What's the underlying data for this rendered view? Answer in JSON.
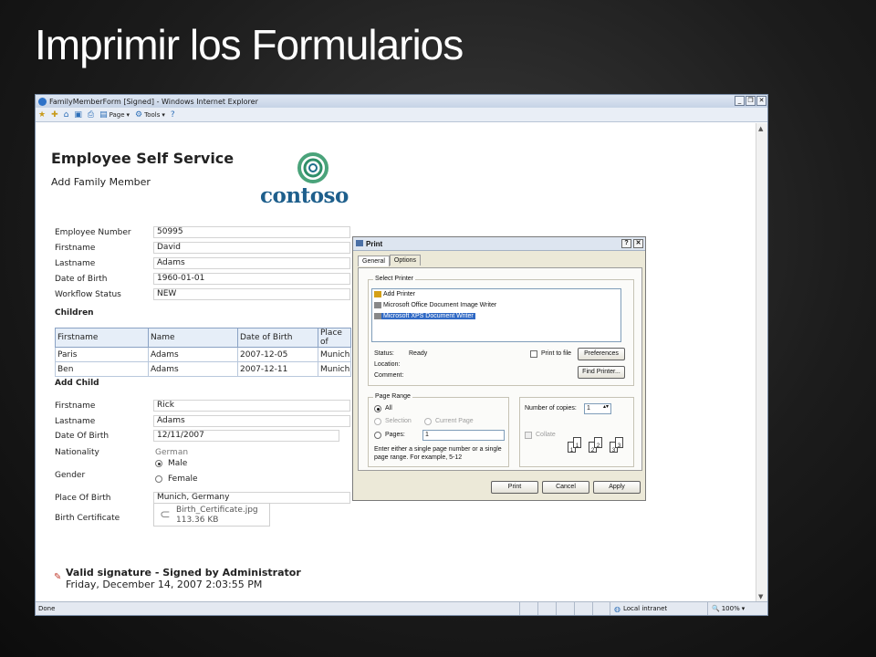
{
  "slide": {
    "title": "Imprimir los Formularios"
  },
  "browser": {
    "title": "FamilyMemberForm [Signed] - Windows Internet Explorer",
    "toolbar": {
      "page": "Page",
      "tools": "Tools"
    },
    "status": {
      "text": "Done",
      "zone": "Local intranet",
      "zoom": "100%"
    }
  },
  "page": {
    "app_title": "Employee Self Service",
    "subtitle": "Add Family Member",
    "logo_text": "contoso",
    "employee": {
      "number_label": "Employee Number",
      "number": "50995",
      "firstname_label": "Firstname",
      "firstname": "David",
      "lastname_label": "Lastname",
      "lastname": "Adams",
      "dob_label": "Date of Birth",
      "dob": "1960-01-01",
      "workflow_label": "Workflow Status",
      "workflow": "NEW"
    },
    "children": {
      "heading": "Children",
      "columns": [
        "Firstname",
        "Name",
        "Date of Birth",
        "Place of"
      ],
      "rows": [
        [
          "Paris",
          "Adams",
          "2007-12-05",
          "Munich"
        ],
        [
          "Ben",
          "Adams",
          "2007-12-11",
          "Munich"
        ]
      ]
    },
    "add_child": {
      "heading": "Add Child",
      "firstname_label": "Firstname",
      "firstname": "Rick",
      "lastname_label": "Lastname",
      "lastname": "Adams",
      "dob_label": "Date Of Birth",
      "dob": "12/11/2007",
      "nationality_label": "Nationality",
      "nationality": "German",
      "gender_label": "Gender",
      "male": "Male",
      "female": "Female",
      "place_label": "Place Of Birth",
      "place": "Munich, Germany",
      "cert_label": "Birth Certificate",
      "cert_file": "Birth_Certificate.jpg",
      "cert_size": "113.36 KB"
    },
    "signature": {
      "line1": "Valid signature - Signed by Administrator",
      "line2": "Friday, December 14, 2007 2:03:55 PM"
    }
  },
  "print_dialog": {
    "title": "Print",
    "tabs": [
      "General",
      "Options"
    ],
    "select_printer_label": "Select Printer",
    "printers": [
      "Add Printer",
      "Microsoft Office Document Image Writer",
      "Microsoft XPS Document Writer"
    ],
    "status_label": "Status:",
    "status_value": "Ready",
    "location_label": "Location:",
    "comment_label": "Comment:",
    "print_to_file": "Print to file",
    "preferences": "Preferences",
    "find_printer": "Find Printer...",
    "page_range_label": "Page Range",
    "all": "All",
    "selection": "Selection",
    "current_page": "Current Page",
    "pages": "Pages:",
    "pages_value": "1",
    "range_hint": "Enter either a single page number or a single page range.  For example, 5-12",
    "copies_label": "Number of copies:",
    "copies_value": "1",
    "collate": "Collate",
    "print_btn": "Print",
    "cancel_btn": "Cancel",
    "apply_btn": "Apply"
  }
}
